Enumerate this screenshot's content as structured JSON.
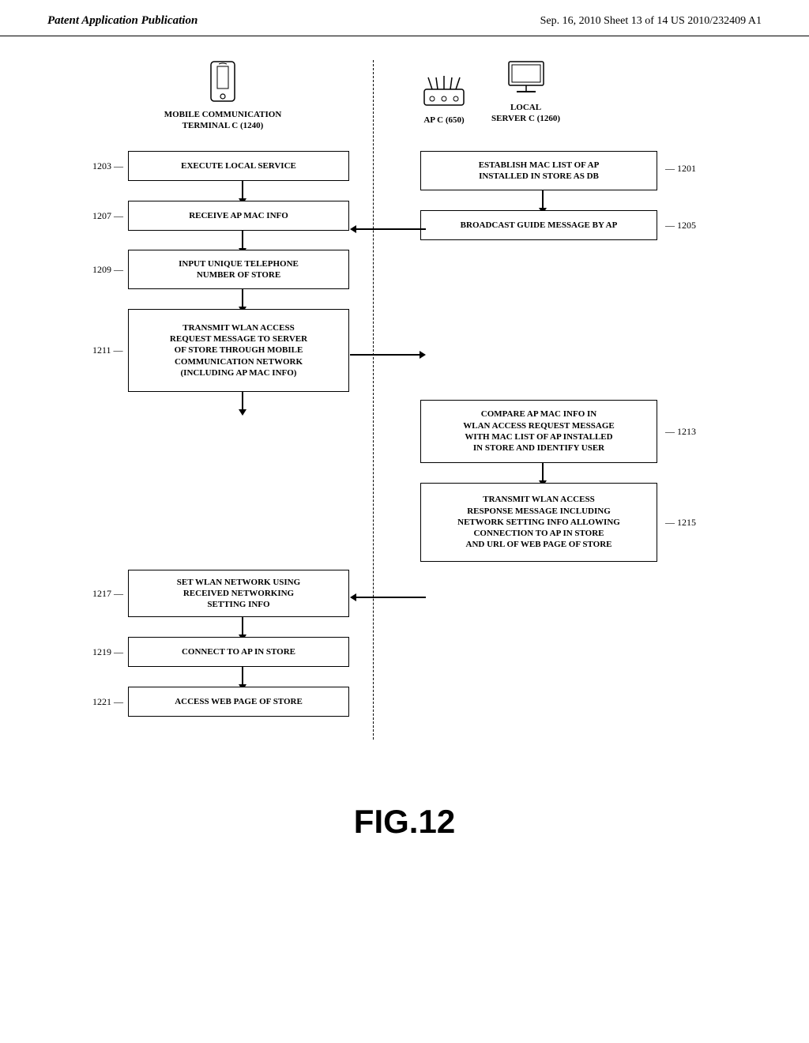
{
  "header": {
    "left_label": "Patent Application Publication",
    "right_label": "Sep. 16, 2010   Sheet 13 of 14   US 2010/232409 A1"
  },
  "figure_caption": "FIG.12",
  "left_column": {
    "title_line1": "MOBILE COMMUNICATION",
    "title_line2": "TERMINAL C (1240)"
  },
  "right_column": {
    "title_line1": "AP C (650)",
    "title_line2": "LOCAL",
    "title_line3": "SERVER C (1260)"
  },
  "steps": [
    {
      "id": "1203",
      "label": "1203",
      "text": "EXECUTE LOCAL SERVICE",
      "col": "left"
    },
    {
      "id": "1207",
      "label": "1207",
      "text": "RECEIVE AP MAC INFO",
      "col": "left"
    },
    {
      "id": "1209",
      "label": "1209",
      "text": "INPUT UNIQUE TELEPHONE\nNUMBER OF STORE",
      "col": "left"
    },
    {
      "id": "1211",
      "label": "1211",
      "text": "TRANSMIT WLAN ACCESS\nREQUEST MESSAGE TO SERVER\nOF STORE THROUGH MOBILE\nCOMMUNICATION NETWORK\n(INCLUDING AP MAC INFO)",
      "col": "left"
    },
    {
      "id": "1217",
      "label": "1217",
      "text": "SET WLAN NETWORK USING\nRECEIVED NETWORKING\nSETTING INFO",
      "col": "left"
    },
    {
      "id": "1219",
      "label": "1219",
      "text": "CONNECT TO AP IN STORE",
      "col": "left"
    },
    {
      "id": "1221",
      "label": "1221",
      "text": "ACCESS WEB PAGE OF STORE",
      "col": "left"
    },
    {
      "id": "1201",
      "label": "1201",
      "text": "ESTABLISH MAC LIST OF AP\nINSTALLED IN STORE AS DB",
      "col": "right"
    },
    {
      "id": "1205",
      "label": "1205",
      "text": "BROADCAST GUIDE MESSAGE BY AP",
      "col": "right"
    },
    {
      "id": "1213",
      "label": "1213",
      "text": "COMPARE AP MAC INFO IN\nWLAN ACCESS REQUEST MESSAGE\nWITH MAC LIST OF AP INSTALLED\nIN STORE AND IDENTIFY USER",
      "col": "right"
    },
    {
      "id": "1215",
      "label": "1215",
      "text": "TRANSMIT WLAN ACCESS\nRESPONSE MESSAGE INCLUDING\nNETWORK SETTING INFO ALLOWING\nCONNECTION TO AP IN STORE\nAND URL OF WEB PAGE OF STORE",
      "col": "right"
    }
  ]
}
